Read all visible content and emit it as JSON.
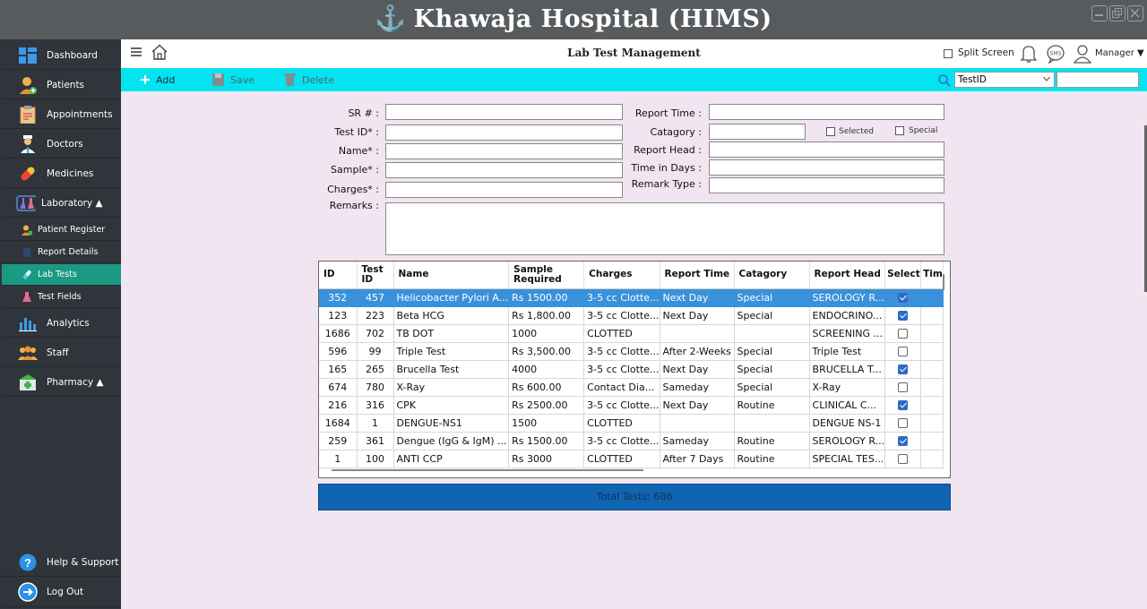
{
  "window": {
    "title": "Khawaja Hospital (HIMS)"
  },
  "sidebar": {
    "items": [
      {
        "label": "Dashboard",
        "icon": "dashboard-icon"
      },
      {
        "label": "Patients",
        "icon": "patient-icon"
      },
      {
        "label": "Appointments",
        "icon": "appointments-icon"
      },
      {
        "label": "Doctors",
        "icon": "doctor-icon"
      },
      {
        "label": "Medicines",
        "icon": "pill-icon"
      },
      {
        "label": "Laboratory ▲",
        "icon": "lab-icon"
      },
      {
        "label": "Analytics",
        "icon": "analytics-icon"
      },
      {
        "label": "Staff",
        "icon": "staff-icon"
      },
      {
        "label": "Pharmacy ▲",
        "icon": "pharmacy-icon"
      }
    ],
    "subitems": [
      {
        "label": "Patient Register"
      },
      {
        "label": "Report Details"
      },
      {
        "label": "Lab Tests"
      },
      {
        "label": "Test Fields"
      }
    ],
    "help": "Help & Support",
    "logout": "Log Out"
  },
  "header": {
    "page_title": "Lab Test Management",
    "split_screen": "Split Screen",
    "user": "Manager ▼"
  },
  "toolbar": {
    "add": "Add",
    "save": "Save",
    "delete": "Delete",
    "search_field": "TestID",
    "search_value": ""
  },
  "form": {
    "sr": "SR # :",
    "test_id": "Test ID* :",
    "name": "Name* :",
    "sample": "Sample* :",
    "charges": "Charges* :",
    "remarks": "Remarks :",
    "report_time": "Report Time :",
    "catagory": "Catagory :",
    "selected": "Selected",
    "special": "Special",
    "report_head": "Report Head :",
    "time_in_days": "Time in Days :",
    "remark_type": "Remark Type :"
  },
  "grid": {
    "columns": [
      "ID",
      "Test ID",
      "Name",
      "Sample Required",
      "Charges",
      "Report Time",
      "Catagory",
      "Report Head",
      "Select",
      "Tim"
    ],
    "rows": [
      {
        "id": "352",
        "test_id": "457",
        "name": "Helicobacter Pylori A...",
        "charges": "Rs 1500.00",
        "sample": "3-5 cc Clotte...",
        "report_time": "Next Day",
        "catagory": "Special",
        "report_head": "SEROLOGY R...",
        "select": true,
        "selected_row": true
      },
      {
        "id": "123",
        "test_id": "223",
        "name": "Beta HCG",
        "charges": "Rs 1,800.00",
        "sample": "3-5 cc Clotte...",
        "report_time": "Next Day",
        "catagory": "Special",
        "report_head": "ENDOCRINO...",
        "select": true
      },
      {
        "id": "1686",
        "test_id": "702",
        "name": "TB DOT",
        "charges": "1000",
        "sample": "CLOTTED",
        "report_time": "",
        "catagory": "",
        "report_head": "SCREENING ...",
        "select": false
      },
      {
        "id": "596",
        "test_id": "99",
        "name": "Triple Test",
        "charges": "Rs 3,500.00",
        "sample": "3-5 cc Clotte...",
        "report_time": "After 2-Weeks",
        "catagory": "Special",
        "report_head": "Triple Test",
        "select": false
      },
      {
        "id": "165",
        "test_id": "265",
        "name": "Brucella Test",
        "charges": "4000",
        "sample": "3-5 cc Clotte...",
        "report_time": "Next Day",
        "catagory": "Special",
        "report_head": "BRUCELLA T...",
        "select": true
      },
      {
        "id": "674",
        "test_id": "780",
        "name": "X-Ray",
        "charges": "Rs 600.00",
        "sample": "Contact Dia...",
        "report_time": "Sameday",
        "catagory": "Special",
        "report_head": "X-Ray",
        "select": false
      },
      {
        "id": "216",
        "test_id": "316",
        "name": "CPK",
        "charges": "Rs 2500.00",
        "sample": "3-5 cc Clotte...",
        "report_time": "Next Day",
        "catagory": "Routine",
        "report_head": "CLINICAL C...",
        "select": true
      },
      {
        "id": "1684",
        "test_id": "1",
        "name": "DENGUE-NS1",
        "charges": "1500",
        "sample": "CLOTTED",
        "report_time": "",
        "catagory": "",
        "report_head": "DENGUE NS-1",
        "select": false
      },
      {
        "id": "259",
        "test_id": "361",
        "name": "Dengue (IgG & IgM) ...",
        "charges": "Rs 1500.00",
        "sample": "3-5 cc Clotte...",
        "report_time": "Sameday",
        "catagory": "Routine",
        "report_head": "SEROLOGY R...",
        "select": true
      },
      {
        "id": "1",
        "test_id": "100",
        "name": "ANTI CCP",
        "charges": "Rs 3000",
        "sample": "CLOTTED",
        "report_time": "After 7 Days",
        "catagory": "Routine",
        "report_head": "SPECIAL TES...",
        "select": false
      }
    ],
    "total": "Total Tests: 686"
  },
  "colors": {
    "accent": "#02e4ef",
    "active_nav": "#1a9a82",
    "selection": "#3a91db",
    "total_bar": "#1065b3"
  }
}
